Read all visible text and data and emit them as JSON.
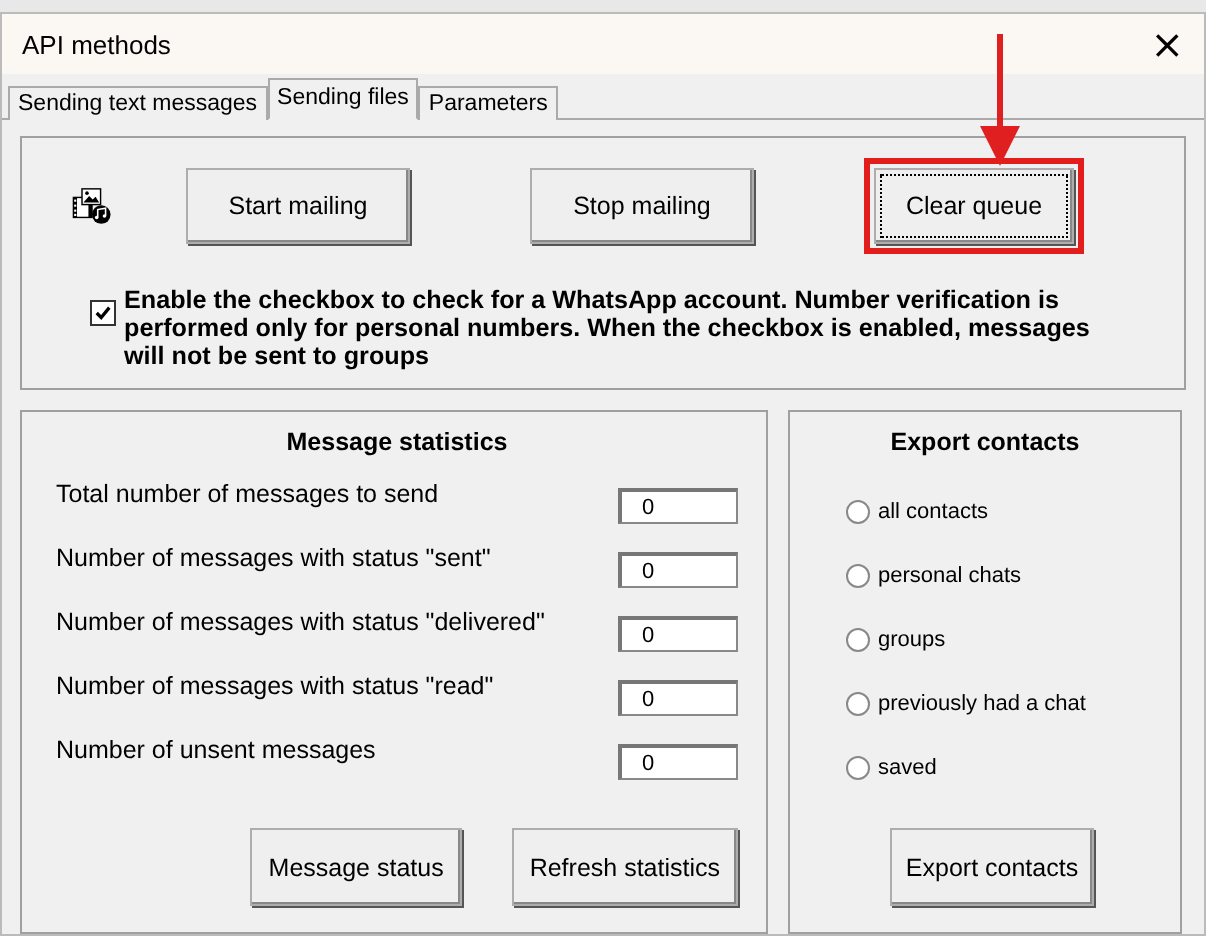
{
  "window": {
    "title": "API methods",
    "close": "×"
  },
  "tabs": [
    {
      "label": "Sending text messages",
      "selected": false
    },
    {
      "label": "Sending files",
      "selected": true
    },
    {
      "label": "Parameters",
      "selected": false
    }
  ],
  "actions": [
    {
      "label": "Start mailing",
      "highlighted": false
    },
    {
      "label": "Stop mailing",
      "highlighted": false
    },
    {
      "label": "Clear queue",
      "highlighted": true
    }
  ],
  "whatsapp_check": {
    "checked": true,
    "label": "Enable the checkbox to check for a WhatsApp account. Number verification is performed only for personal numbers. When the checkbox is enabled, messages will not be sent to groups"
  },
  "statistics": {
    "title": "Message statistics",
    "rows": [
      {
        "label": "Total number of messages to send",
        "value": "0"
      },
      {
        "label": "Number of messages with status \"sent\"",
        "value": "0"
      },
      {
        "label": "Number of messages with status \"delivered\"",
        "value": "0"
      },
      {
        "label": "Number of messages with status \"read\"",
        "value": "0"
      },
      {
        "label": "Number of unsent messages",
        "value": "0"
      }
    ],
    "buttons": [
      "Message status",
      "Refresh statistics"
    ]
  },
  "export": {
    "title": "Export contacts",
    "options": [
      {
        "label": "all contacts",
        "selected": false
      },
      {
        "label": "personal chats",
        "selected": false
      },
      {
        "label": "groups",
        "selected": false
      },
      {
        "label": "previously had a chat",
        "selected": false
      },
      {
        "label": "saved",
        "selected": false
      }
    ],
    "button": "Export contacts"
  }
}
